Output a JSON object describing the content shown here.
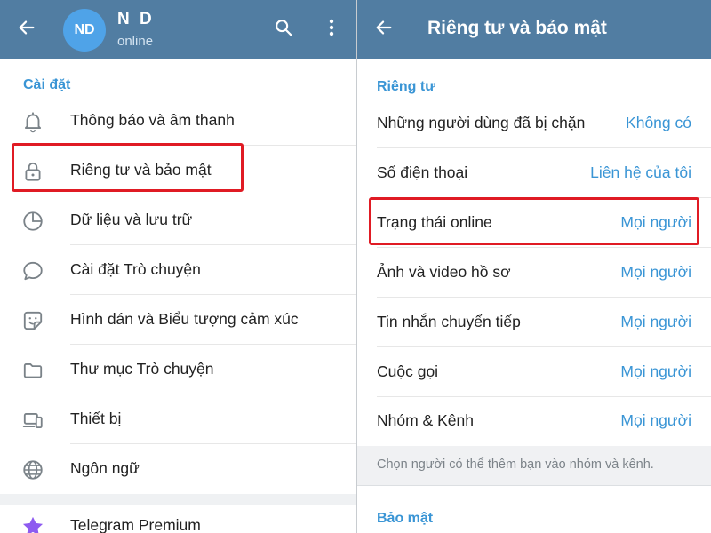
{
  "colors": {
    "header": "#517da2",
    "accent": "#3a95d5",
    "avatar": "#4fa3e8",
    "highlight": "#e01b24",
    "premium_star": "#8e5bf0"
  },
  "settings_screen": {
    "header": {
      "back_icon": "arrow-left-icon",
      "avatar_initials": "ND",
      "name": "N D",
      "status": "online",
      "search_icon": "search-icon",
      "more_icon": "more-vertical-icon"
    },
    "section_title": "Cài đặt",
    "items": [
      {
        "label": "Thông báo và âm thanh",
        "icon": "bell-icon"
      },
      {
        "label": "Riêng tư và bảo mật",
        "icon": "lock-icon",
        "highlighted": true
      },
      {
        "label": "Dữ liệu và lưu trữ",
        "icon": "clock-pie-icon"
      },
      {
        "label": "Cài đặt Trò chuyện",
        "icon": "chat-bubble-icon"
      },
      {
        "label": "Hình dán và Biểu tượng cảm xúc",
        "icon": "sticker-icon"
      },
      {
        "label": "Thư mục Trò chuyện",
        "icon": "folder-icon"
      },
      {
        "label": "Thiết bị",
        "icon": "devices-icon"
      },
      {
        "label": "Ngôn ngữ",
        "icon": "globe-icon"
      }
    ],
    "premium": {
      "label": "Telegram Premium",
      "icon": "star-icon"
    }
  },
  "privacy_screen": {
    "header": {
      "back_icon": "arrow-left-icon",
      "title": "Riêng tư và bảo mật"
    },
    "privacy_section_title": "Riêng tư",
    "rows": [
      {
        "label": "Những người dùng đã bị chặn",
        "value": "Không có"
      },
      {
        "label": "Số điện thoại",
        "value": "Liên hệ của tôi"
      },
      {
        "label": "Trạng thái online",
        "value": "Mọi người",
        "highlighted": true
      },
      {
        "label": "Ảnh và video hồ sơ",
        "value": "Mọi người"
      },
      {
        "label": "Tin nhắn chuyển tiếp",
        "value": "Mọi người"
      },
      {
        "label": "Cuộc gọi",
        "value": "Mọi người"
      },
      {
        "label": "Nhóm & Kênh",
        "value": "Mọi người"
      }
    ],
    "groups_hint": "Chọn người có thể thêm bạn vào nhóm và kênh.",
    "security_section_title": "Bảo mật"
  }
}
